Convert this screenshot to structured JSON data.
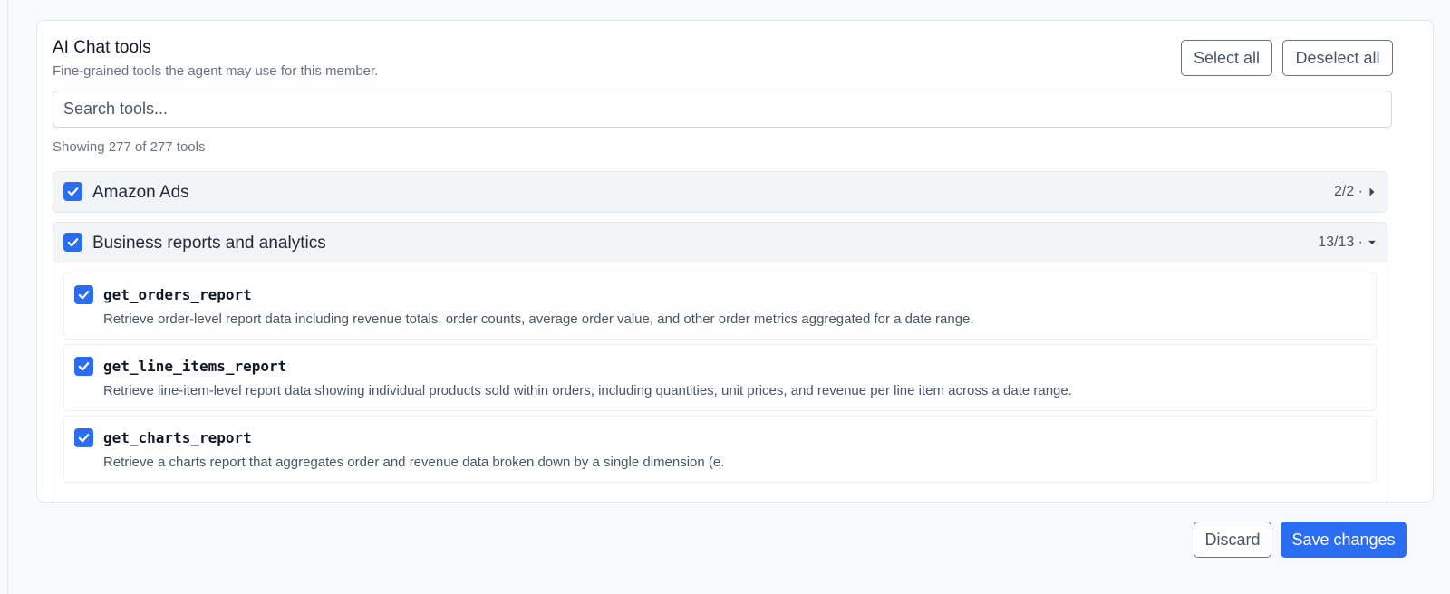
{
  "panel": {
    "title": "AI Chat tools",
    "subtitle": "Fine-grained tools the agent may use for this member.",
    "select_all_label": "Select all",
    "deselect_all_label": "Deselect all"
  },
  "search": {
    "placeholder": "Search tools...",
    "value": ""
  },
  "showing_text": "Showing 277 of 277 tools",
  "groups": [
    {
      "label": "Amazon Ads",
      "count": "2/2 ·",
      "checked": true,
      "expanded": false,
      "caret_icon": "caret-right-icon"
    },
    {
      "label": "Business reports and analytics",
      "count": "13/13 ·",
      "checked": true,
      "expanded": true,
      "caret_icon": "caret-down-icon",
      "tools": [
        {
          "name": "get_orders_report",
          "description": "Retrieve order-level report data including revenue totals, order counts, average order value, and other order metrics aggregated for a date range.",
          "checked": true
        },
        {
          "name": "get_line_items_report",
          "description": "Retrieve line-item-level report data showing individual products sold within orders, including quantities, unit prices, and revenue per line item across a date range.",
          "checked": true
        },
        {
          "name": "get_charts_report",
          "description": "Retrieve a charts report that aggregates order and revenue data broken down by a single dimension (e.",
          "checked": true
        }
      ]
    }
  ],
  "footer": {
    "discard_label": "Discard",
    "save_label": "Save changes"
  },
  "colors": {
    "accent": "#2b6df0",
    "group_header_bg": "#f2f4f7",
    "muted_text": "#6b7280"
  }
}
